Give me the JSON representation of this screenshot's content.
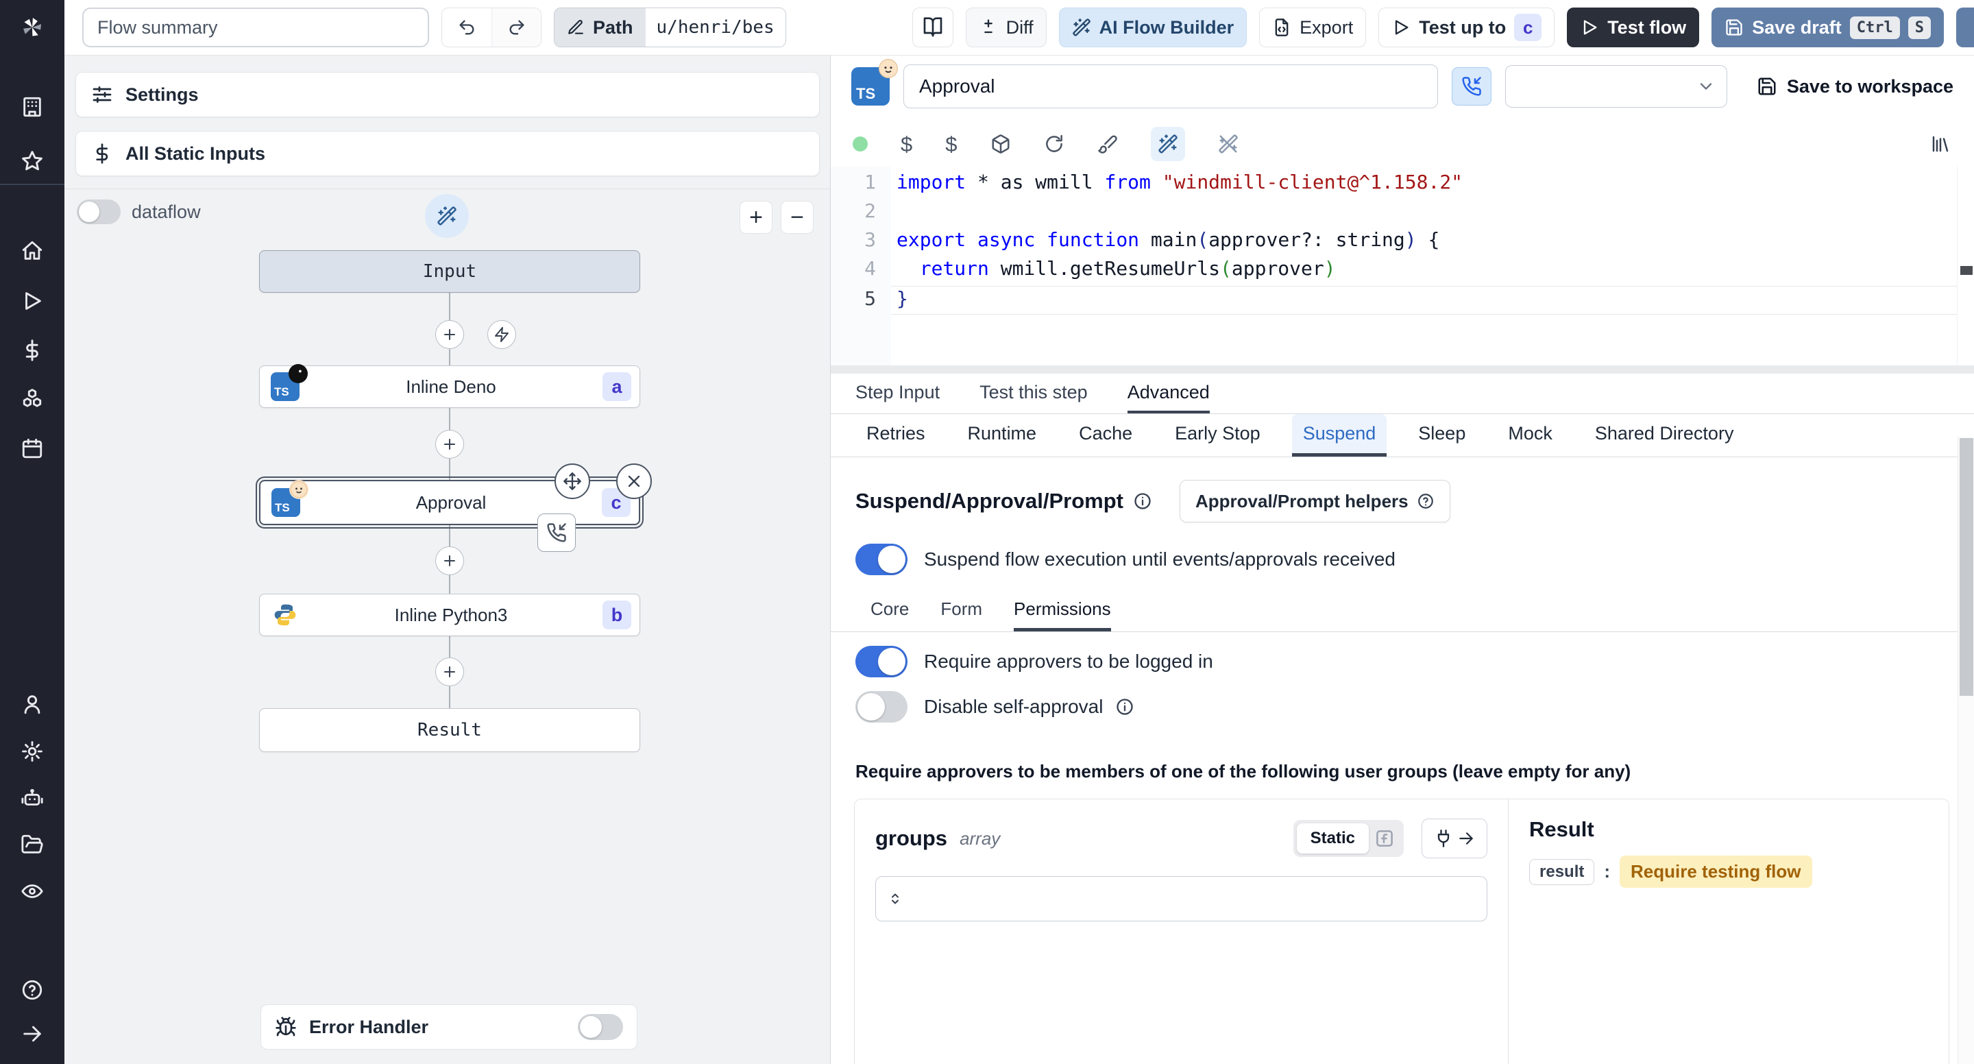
{
  "topbar": {
    "flow_summary_placeholder": "Flow summary",
    "path": {
      "label": "Path",
      "value": "u/henri/bes"
    },
    "diff_label": "Diff",
    "ai_flow_builder_label": "AI Flow Builder",
    "export_label": "Export",
    "test_up_to": {
      "label": "Test up to",
      "badge": "c"
    },
    "test_flow_label": "Test flow",
    "save_draft": {
      "label": "Save draft",
      "kbd1": "Ctrl",
      "kbd2": "S"
    }
  },
  "left_panel": {
    "settings_label": "Settings",
    "all_static_inputs_label": "All Static Inputs",
    "dataflow_label": "dataflow",
    "zoom_in_label": "+",
    "zoom_out_label": "−",
    "error_handler_label": "Error Handler",
    "graph": {
      "input_label": "Input",
      "result_label": "Result",
      "nodes": [
        {
          "label": "Inline Deno",
          "badge": "a",
          "lang": "TS"
        },
        {
          "label": "Approval",
          "badge": "c",
          "lang": "TS"
        },
        {
          "label": "Inline Python3",
          "badge": "b",
          "lang": "Python"
        }
      ]
    }
  },
  "step_editor": {
    "name_value": "Approval",
    "lang_badge": "TS",
    "save_to_workspace_label": "Save to workspace",
    "code": {
      "nums": [
        "1",
        "2",
        "3",
        "4",
        "5"
      ],
      "l1": {
        "kw1": "import",
        "mid": " * as wmill ",
        "kw2": "from",
        "str": " \"windmill-client@^1.158.2\""
      },
      "l3": {
        "kw1": "export ",
        "kw2": "async ",
        "kw3": "function",
        "fn": " main",
        "p1": "(",
        "args": "approver?: string",
        "p2": ")",
        "brace": " {"
      },
      "l4": {
        "kw": "  return",
        "mid": " wmill.getResumeUrls",
        "p1": "(",
        "arg": "approver",
        "p2": ")"
      },
      "l5": {
        "brace": "}"
      }
    },
    "tabs": [
      {
        "label": "Step Input"
      },
      {
        "label": "Test this step"
      },
      {
        "label": "Advanced"
      }
    ],
    "subtabs": [
      {
        "label": "Retries"
      },
      {
        "label": "Runtime"
      },
      {
        "label": "Cache"
      },
      {
        "label": "Early Stop"
      },
      {
        "label": "Suspend"
      },
      {
        "label": "Sleep"
      },
      {
        "label": "Mock"
      },
      {
        "label": "Shared Directory"
      }
    ]
  },
  "suspend_section": {
    "title": "Suspend/Approval/Prompt",
    "helpers_button_label": "Approval/Prompt helpers",
    "suspend_toggle_label": "Suspend flow execution until events/approvals received",
    "inner_tabs": [
      {
        "label": "Core"
      },
      {
        "label": "Form"
      },
      {
        "label": "Permissions"
      }
    ],
    "require_login_label": "Require approvers to be logged in",
    "disable_self_approval_label": "Disable self-approval",
    "groups_hint": "Require approvers to be members of one of the following user groups (leave empty for any)"
  },
  "groups_panel": {
    "name": "groups",
    "type": "array",
    "static_label": "Static"
  },
  "result_panel": {
    "title": "Result",
    "key": "result",
    "colon": ":",
    "value": "Require testing flow"
  },
  "colors": {
    "accent_blue": "#3a70dd",
    "badge_bg": "#e1e7fc",
    "badge_text": "#4338ca",
    "yellow_chip_bg": "#fdf0bf",
    "yellow_chip_text": "#a16207",
    "code_keyword": "#0000ff",
    "code_string": "#a31515",
    "rail_bg": "#20232e",
    "save_draft_bg": "#617ea7"
  }
}
